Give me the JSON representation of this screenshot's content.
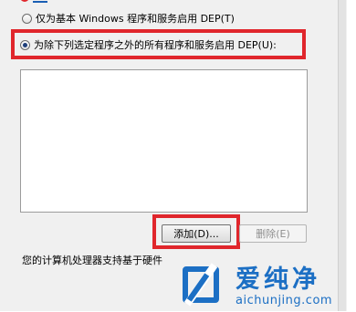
{
  "options": {
    "essential_only": "仅为基本 Windows 程序和服务启用 DEP(T)",
    "all_except": "为除下列选定程序之外的所有程序和服务启用 DEP(U):"
  },
  "buttons": {
    "add": "添加(D)...",
    "remove": "删除(E)"
  },
  "status_text": "您的计算机处理器支持基于硬件",
  "watermark": {
    "name": "爱纯净",
    "url": "aichunjing.com"
  },
  "colors": {
    "highlight": "#e0262c",
    "brand": "#1c6fc4"
  }
}
